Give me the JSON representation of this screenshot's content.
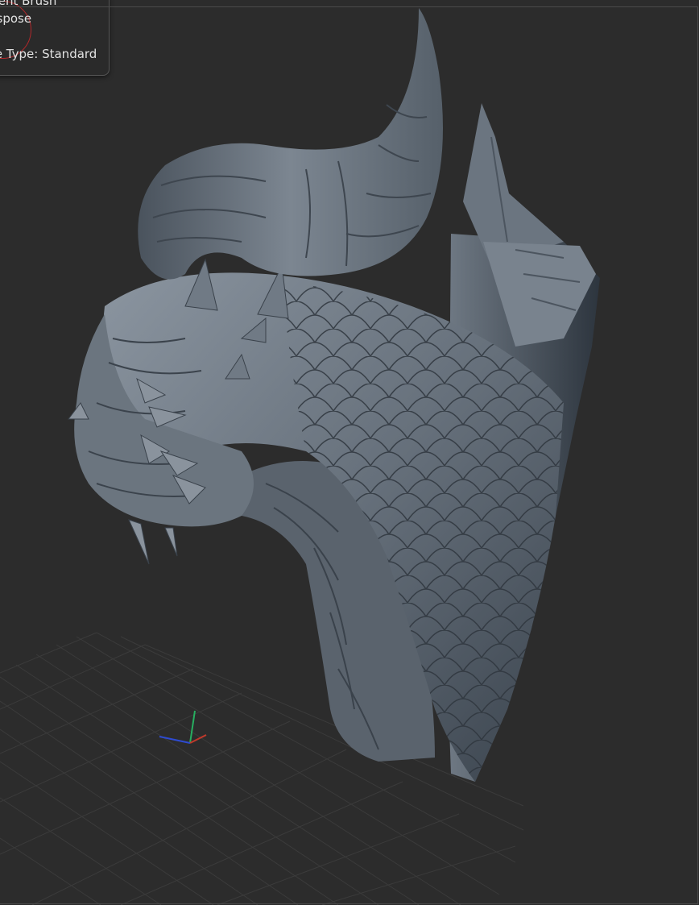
{
  "overlay": {
    "current_brush": "rrent Brush",
    "transpose": "nspose",
    "transpose_type": "se Type: Standard"
  },
  "colors": {
    "background": "#2c2c2c",
    "grid_line": "#3a3a3a",
    "model_base": "#5d6670",
    "model_highlight": "#9aa3ad",
    "model_shadow": "#232a31",
    "brush_ring": "#b0282a",
    "axis_x": "#c0392b",
    "axis_y": "#27ae60",
    "axis_z": "#2e4bd1"
  },
  "model": {
    "subject": "sculpted dragon head with horns and scales",
    "icon": "3d-model"
  }
}
